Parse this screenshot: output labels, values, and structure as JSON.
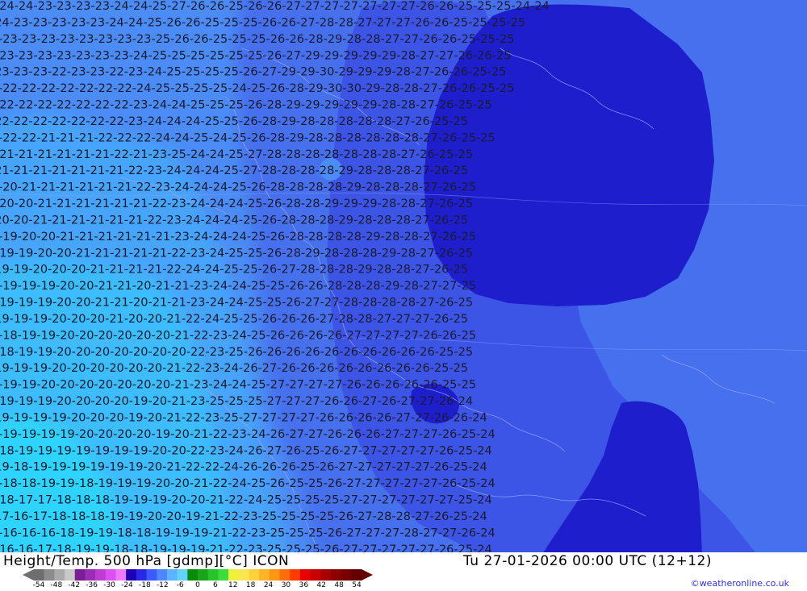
{
  "header": {
    "title": "Height/Temp. 500 hPa [gdmp][°C] ICON",
    "valid_time": "Tu 27-01-2026 00:00 UTC (12+12)",
    "credit": "©weatheronline.co.uk"
  },
  "legend": {
    "ticks": [
      "-54",
      "-48",
      "-42",
      "-36",
      "-30",
      "-24",
      "-18",
      "-12",
      "-6",
      "0",
      "6",
      "12",
      "18",
      "24",
      "30",
      "36",
      "42",
      "48",
      "54"
    ],
    "colors": [
      "#6e6e6e",
      "#8c8c8c",
      "#aaaaaa",
      "#c8c8c8",
      "#7a1e96",
      "#9b2db4",
      "#be3cd2",
      "#dc50f0",
      "#f078ff",
      "#1e00b4",
      "#2828e6",
      "#3c5aff",
      "#4f86ff",
      "#5ab4ff",
      "#64d2ff",
      "#0a8c0a",
      "#19a519",
      "#28c328",
      "#3cdc3c",
      "#f0f03c",
      "#fae650",
      "#ffd23c",
      "#ffb428",
      "#ff9614",
      "#ff6e0a",
      "#ff3c00",
      "#e60000",
      "#c80000",
      "#aa0000",
      "#8c0000",
      "#780000",
      "#640000"
    ]
  },
  "map": {
    "colors": {
      "cyan_light": "#2fd4ff",
      "cyan": "#3dbcff",
      "sky": "#46a4ff",
      "light_blue": "#4b8cf8",
      "blue": "#4670ee",
      "medium_blue": "#3c55e6",
      "dark_blue": "#1e1ecc"
    },
    "rows": [
      "-24-24-23-23-23-23-24-24-25-27-26-26-25-26-26-27-27-27-27-27-27-27-26-26-25-25-25-24-24",
      "-24-23-23-23-23-23-24-24-25-26-26-25-25-25-26-26-27-28-28-27-27-27-26-26-25-25-25-25",
      "-23-23-23-23-23-23-23-23-25-26-26-25-25-25-26-26-28-29-28-28-27-27-26-26-25-25-25",
      "-23-23-23-23-23-23-23-24-25-25-25-25-25-25-26-27-29-29-29-29-29-28-27-27-26-26-25",
      "-23-23-23-22-23-23-22-23-24-25-25-25-25-26-27-29-29-30-29-29-29-28-27-26-26-25-25",
      "-22-22-22-22-22-22-22-24-25-25-25-25-24-25-26-28-29-30-30-29-28-28-27-26-26-25-25",
      "-22-22-22-22-22-22-22-23-24-24-25-25-25-26-28-29-29-29-29-29-28-28-27-26-25-25",
      "-22-22-22-22-22-22-22-23-24-24-24-25-25-26-28-29-28-28-28-28-28-27-26-25-25",
      "-22-22-21-21-21-22-22-22-24-24-25-24-25-26-28-29-28-28-28-28-28-28-27-26-25-25",
      "-21-21-21-21-21-21-22-21-23-25-24-24-25-27-28-28-28-28-28-28-28-27-26-25-25",
      "-21-21-21-21-21-21-21-22-23-24-24-24-25-27-28-28-28-28-29-28-28-28-27-26-25",
      "-20-21-21-21-21-21-21-22-23-24-24-24-25-26-28-28-28-28-29-28-28-28-27-26-25",
      "-20-20-21-21-21-21-21-21-22-23-24-24-24-25-26-28-28-29-29-29-28-28-27-26-25",
      "-20-20-21-21-21-21-21-21-22-23-24-24-24-25-26-28-28-28-29-28-28-28-27-26-25",
      "-19-20-20-21-21-21-21-21-21-23-24-24-24-25-26-28-28-28-28-29-28-28-27-26-25",
      "-19-19-20-20-21-21-21-21-21-22-23-24-25-25-26-28-29-28-28-28-29-28-27-26-25",
      "-19-19-20-20-20-21-21-21-21-22-24-24-25-25-26-27-28-28-28-29-28-28-27-26-25",
      "-19-19-19-20-20-21-21-20-21-21-23-24-24-25-25-26-26-28-28-28-29-28-27-27-25",
      "-19-19-19-20-20-21-21-20-21-21-23-24-24-25-25-26-27-27-28-28-28-28-27-26-25",
      "-19-19-19-20-20-20-21-20-20-21-22-24-25-25-26-26-26-27-28-28-27-27-27-26-25",
      "-18-19-19-20-20-20-20-20-20-21-22-23-24-25-26-26-26-26-27-27-27-27-26-26-25",
      "-18-19-19-20-20-20-20-20-20-20-22-23-25-26-26-26-26-26-26-26-26-26-26-25-25",
      "-19-19-19-20-20-20-20-20-20-21-22-23-24-26-27-26-26-26-26-26-26-26-26-25-25",
      "-19-19-20-20-20-20-20-20-20-21-23-24-24-25-27-27-27-27-26-26-26-26-26-25-25",
      "-19-19-19-20-20-20-20-19-20-21-23-25-25-25-27-27-27-26-26-27-26-27-27-26-24",
      "-19-19-19-19-20-20-20-19-20-21-22-23-25-27-27-27-27-26-26-26-26-27-27-26-26-24",
      "-19-19-19-19-20-20-20-20-19-20-21-22-23-24-26-27-27-26-26-26-27-27-27-26-25-24",
      "-18-19-19-19-19-19-19-19-20-20-22-23-24-26-27-26-25-26-27-27-27-27-27-26-25-24",
      "-19-18-19-19-19-19-19-19-20-21-22-22-24-26-26-26-25-26-27-27-27-27-27-26-25-24",
      "-18-18-19-19-18-19-19-19-20-20-21-22-24-25-26-25-25-26-27-27-27-27-27-26-25-24",
      "-18-17-17-18-18-18-19-19-19-20-20-21-22-24-25-25-25-25-27-27-27-27-27-27-25-24",
      "-17-16-17-18-18-18-19-19-20-20-19-21-22-23-25-25-25-25-26-27-28-28-27-26-25-24",
      "-16-16-16-18-19-19-18-18-19-19-19-21-22-23-25-25-25-26-27-27-27-28-27-27-26-24",
      "-16-16-17-18-19-19-18-18-19-19-19-21-22-23-25-25-25-26-27-27-27-27-27-26-25-24"
    ]
  }
}
